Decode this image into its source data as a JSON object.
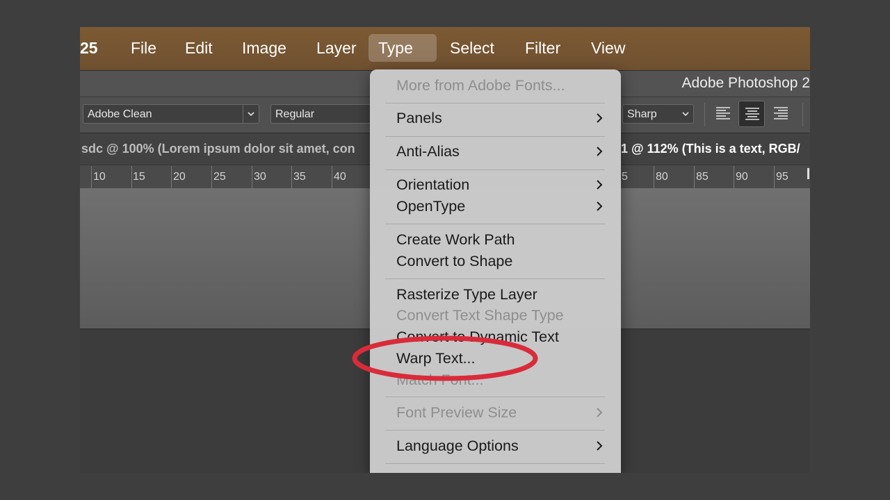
{
  "menubar": {
    "items": [
      {
        "label": "25"
      },
      {
        "label": "File"
      },
      {
        "label": "Edit"
      },
      {
        "label": "Image"
      },
      {
        "label": "Layer"
      },
      {
        "label": "Type"
      },
      {
        "label": "Select"
      },
      {
        "label": "Filter"
      },
      {
        "label": "View"
      }
    ],
    "active": "Type"
  },
  "window": {
    "title": "Adobe Photoshop 2"
  },
  "options": {
    "font_family": "Adobe Clean",
    "font_style": "Regular",
    "anti_alias": "Sharp",
    "align_icons": [
      "align-left-icon",
      "align-center-icon",
      "align-right-icon"
    ],
    "align_active": "align-center-icon"
  },
  "tabs": [
    {
      "label": "sdc @ 100% (Lorem ipsum dolor sit amet, con",
      "active": false
    },
    {
      "label": "1 @ 112% (This is a text, RGB/",
      "active": true
    }
  ],
  "ruler": {
    "labels": [
      "10",
      "15",
      "20",
      "25",
      "30",
      "35",
      "40",
      "5",
      "80",
      "85",
      "90",
      "95"
    ]
  },
  "type_menu": {
    "more_fonts": "More from Adobe Fonts...",
    "panels": "Panels",
    "anti_alias": "Anti-Alias",
    "orientation": "Orientation",
    "opentype": "OpenType",
    "create_work_path": "Create Work Path",
    "convert_to_shape": "Convert to Shape",
    "rasterize": "Rasterize Type Layer",
    "convert_text_shape_type": "Convert Text Shape Type",
    "convert_dynamic": "Convert to Dynamic Text",
    "warp_text": "Warp Text...",
    "match_font": "Match Font...",
    "font_preview_size": "Font Preview Size",
    "language_options": "Language Options"
  },
  "annotation": {
    "color": "#d92b3a",
    "target": "Warp Text..."
  },
  "colors": {
    "menubar": "#7a5833",
    "menu_bg": "#cbcbcb",
    "text_disabled": "#8e8e8e"
  }
}
